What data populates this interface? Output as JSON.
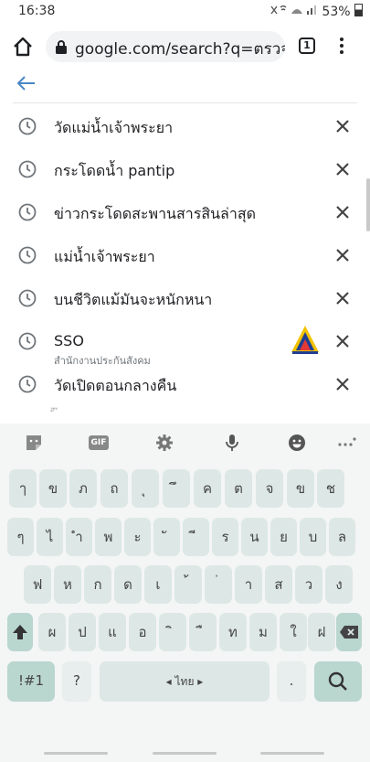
{
  "status": {
    "time": "16:38",
    "battery": "53%",
    "icons": "🔇📶"
  },
  "toolbar": {
    "url": "google.com/search?q=ตรวจพ",
    "tab_count": "1"
  },
  "suggestions": [
    {
      "text": "วัดแม่น้ำเจ้าพระยา",
      "sub": "",
      "has_logo": false
    },
    {
      "text": "กระโดดน้ำ pantip",
      "sub": "",
      "has_logo": false
    },
    {
      "text": "ข่าวกระโดดสะพานสารสินล่าสุด",
      "sub": "",
      "has_logo": false
    },
    {
      "text": "แม่น้ำเจ้าพระยา",
      "sub": "",
      "has_logo": false
    },
    {
      "text": "บนชีวิตแม้มันจะหนักหนา",
      "sub": "",
      "has_logo": false
    },
    {
      "text": "SSO",
      "sub": "สำนักงานประกันสังคม",
      "has_logo": true
    },
    {
      "text": "วัดเปิดตอนกลางคืน",
      "sub": "",
      "has_logo": false
    }
  ],
  "peek_text": "ั้ ๊",
  "keyboard": {
    "rows": [
      [
        "ๅ",
        "ข",
        "ภ",
        "ถ",
        "ุ",
        "ึ",
        "ค",
        "ต",
        "จ",
        "ข",
        "ช"
      ],
      [
        "ๆ",
        "ไ",
        "ำ",
        "พ",
        "ะ",
        "ั",
        "ี",
        "ร",
        "น",
        "ย",
        "บ",
        "ล"
      ],
      [
        "ฟ",
        "ห",
        "ก",
        "ด",
        "เ",
        "้",
        "่",
        "า",
        "ส",
        "ว",
        "ง"
      ],
      [
        "ผ",
        "ป",
        "แ",
        "อ",
        "ิ",
        "ื",
        "ท",
        "ม",
        "ใ",
        "ฝ"
      ]
    ],
    "sym_label": "!#1",
    "question": "?",
    "space_label": "◂ ไทย ▸",
    "period": ".",
    "gif_label": "GIF"
  }
}
